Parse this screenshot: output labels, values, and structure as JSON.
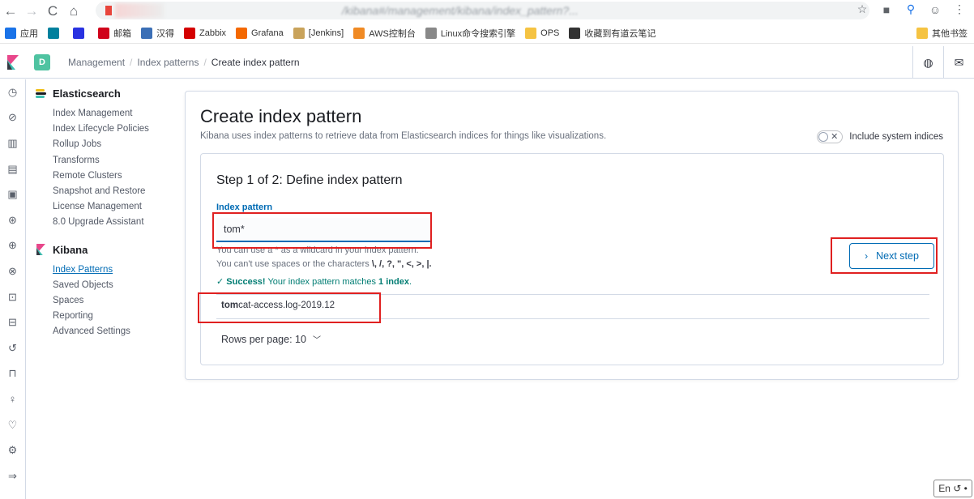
{
  "browser": {
    "url": "/kibana#/management/kibana/index_pattern?...",
    "bookmarks": [
      {
        "label": "应用",
        "icon": "apps-grid-icon",
        "color": "#1a73e8"
      },
      {
        "label": "",
        "icon": "bing-icon",
        "color": "#00809d"
      },
      {
        "label": "",
        "icon": "baidu-paw-icon",
        "color": "#2932e1"
      },
      {
        "label": "邮箱",
        "icon": "mail-163-icon",
        "color": "#d0021b"
      },
      {
        "label": "汉得",
        "icon": "hand-icon",
        "color": "#3b6fb6"
      },
      {
        "label": "Zabbix",
        "icon": "zabbix-icon",
        "color": "#d40000"
      },
      {
        "label": "Grafana",
        "icon": "grafana-icon",
        "color": "#f46800"
      },
      {
        "label": "[Jenkins]",
        "icon": "jenkins-icon",
        "color": "#c9a35b"
      },
      {
        "label": "AWS控制台",
        "icon": "aws-icon",
        "color": "#f08a24"
      },
      {
        "label": "Linux命令搜索引擎",
        "icon": "linux-icon",
        "color": "#888888"
      },
      {
        "label": "OPS",
        "icon": "folder-icon",
        "color": "#f5c342"
      },
      {
        "label": "收藏到有道云笔记",
        "icon": "youdao-icon",
        "color": "#333333"
      }
    ],
    "other_bookmarks": "其他书签"
  },
  "header": {
    "space_initial": "D",
    "breadcrumbs": [
      "Management",
      "Index patterns",
      "Create index pattern"
    ]
  },
  "sidebar": {
    "elasticsearch": {
      "title": "Elasticsearch",
      "items": [
        "Index Management",
        "Index Lifecycle Policies",
        "Rollup Jobs",
        "Transforms",
        "Remote Clusters",
        "Snapshot and Restore",
        "License Management",
        "8.0 Upgrade Assistant"
      ]
    },
    "kibana": {
      "title": "Kibana",
      "items": [
        "Index Patterns",
        "Saved Objects",
        "Spaces",
        "Reporting",
        "Advanced Settings"
      ]
    }
  },
  "main": {
    "title": "Create index pattern",
    "description": "Kibana uses index patterns to retrieve data from Elasticsearch indices for things like visualizations.",
    "include_system_label": "Include system indices",
    "include_system_enabled": false,
    "step_title": "Step 1 of 2: Define index pattern",
    "field_label": "Index pattern",
    "input_value": "tom*",
    "help_line1": "You can use a * as a wildcard in your index pattern.",
    "help_line2_prefix": "You can't use spaces or the characters ",
    "help_line2_chars": "\\, /, ?, \", <, >, |.",
    "success_prefix": "Success!",
    "success_text": " Your index pattern matches ",
    "success_count": "1 index",
    "success_suffix": ".",
    "match_highlight": "tom",
    "match_rest": "cat-access.log-2019.12",
    "rows_per_page": "Rows per page: 10",
    "next_button": "Next step"
  },
  "ime": "En"
}
